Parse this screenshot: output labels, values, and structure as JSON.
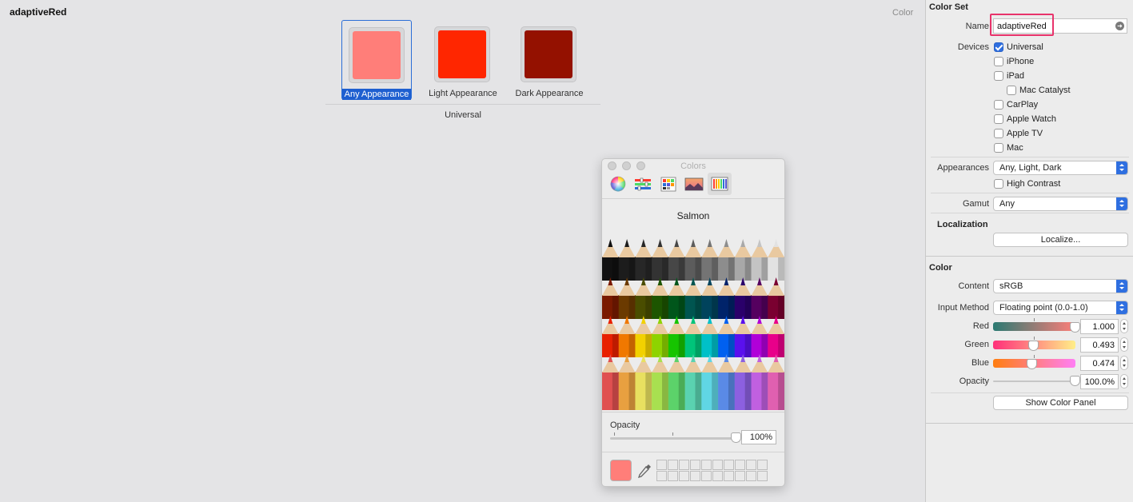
{
  "canvas": {
    "asset_name": "adaptiveRed",
    "type_label": "Color",
    "slots": [
      {
        "label": "Any Appearance",
        "color": "#ff7e79",
        "selected": true
      },
      {
        "label": "Light Appearance",
        "color": "#ff2600",
        "selected": false
      },
      {
        "label": "Dark Appearance",
        "color": "#941100",
        "selected": false
      }
    ],
    "group_label": "Universal"
  },
  "colors_panel": {
    "title": "Colors",
    "mode_icons": [
      "color-wheel-icon",
      "color-sliders-icon",
      "color-palettes-icon",
      "image-palettes-icon",
      "pencils-icon"
    ],
    "active_mode": "pencils-icon",
    "selected_color_name": "Salmon",
    "opacity_label": "Opacity",
    "opacity_value": "100%",
    "opacity_fraction": 1.0,
    "current_color": "#ff7e79"
  },
  "inspector": {
    "color_set_title": "Color Set",
    "name_label": "Name",
    "name_value": "adaptiveRed",
    "devices_label": "Devices",
    "devices": [
      {
        "label": "Universal",
        "checked": true
      },
      {
        "label": "iPhone",
        "checked": false
      },
      {
        "label": "iPad",
        "checked": false
      },
      {
        "label": "Mac Catalyst",
        "checked": false
      },
      {
        "label": "CarPlay",
        "checked": false
      },
      {
        "label": "Apple Watch",
        "checked": false
      },
      {
        "label": "Apple TV",
        "checked": false
      },
      {
        "label": "Mac",
        "checked": false
      }
    ],
    "appearances_label": "Appearances",
    "appearances_value": "Any, Light, Dark",
    "high_contrast_label": "High Contrast",
    "gamut_label": "Gamut",
    "gamut_value": "Any",
    "localization_title": "Localization",
    "localize_button": "Localize...",
    "color_title": "Color",
    "content_label": "Content",
    "content_value": "sRGB",
    "input_method_label": "Input Method",
    "input_method_value": "Floating point (0.0-1.0)",
    "components": [
      {
        "label": "Red",
        "value": "1.000",
        "fraction": 1.0,
        "gradient": [
          "#2a7a72",
          "#ff7e79"
        ]
      },
      {
        "label": "Green",
        "value": "0.493",
        "fraction": 0.493,
        "gradient": [
          "#ff2f7a",
          "#ffee88"
        ]
      },
      {
        "label": "Blue",
        "value": "0.474",
        "fraction": 0.474,
        "gradient": [
          "#ff7e10",
          "#ff7ef5"
        ]
      }
    ],
    "opacity_label": "Opacity",
    "opacity_value": "100.0%",
    "opacity_fraction": 1.0,
    "show_color_panel_button": "Show Color Panel",
    "highlight_color": "#e8336b"
  }
}
